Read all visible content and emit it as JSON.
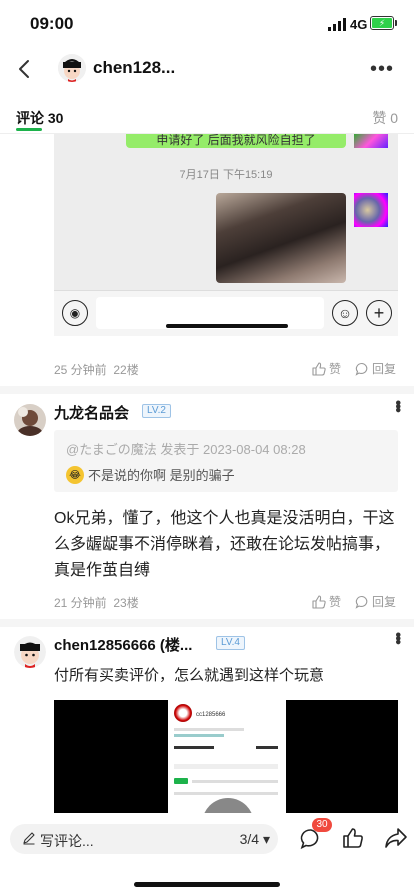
{
  "status_bar": {
    "time": "09:00",
    "network": "4G"
  },
  "header": {
    "title": "chen128..."
  },
  "tabs": {
    "comments_label": "评论",
    "comments_count": "30",
    "likes_label": "赞",
    "likes_count": "0"
  },
  "chat_screenshot": {
    "timestamp": "7月17日 下午15:19",
    "partial_bubble_text": "申请好了 后面我就风险自担了"
  },
  "comments": [
    {
      "time": "25 分钟前",
      "floor": "22楼",
      "like_label": "赞",
      "reply_label": "回复"
    },
    {
      "username": "九龙名品会",
      "level": "LV.2",
      "quote_meta": "@たまごの魔法 发表于 2023-08-04 08:28",
      "quote_text": "不是说的你啊 是别的骗子",
      "body": "Ok兄弟，懂了，他这个人也真是没活明白，干这么多龌龊事不消停眯着，还敢在论坛发帖搞事，真是作茧自缚",
      "time": "21 分钟前",
      "floor": "23楼",
      "like_label": "赞",
      "reply_label": "回复"
    },
    {
      "username": "chen12856666 (楼...",
      "level": "LV.4",
      "body": "付所有买卖评价，怎么就遇到这样个玩意",
      "video_user": "cc1285666"
    }
  ],
  "bottom_bar": {
    "write_label": "写评论...",
    "page_indicator": "3/4 ▾",
    "comment_badge": "30"
  },
  "colors": {
    "accent": "#1db24b",
    "badge": "#f04a3e",
    "level": "#5b9bd5"
  }
}
